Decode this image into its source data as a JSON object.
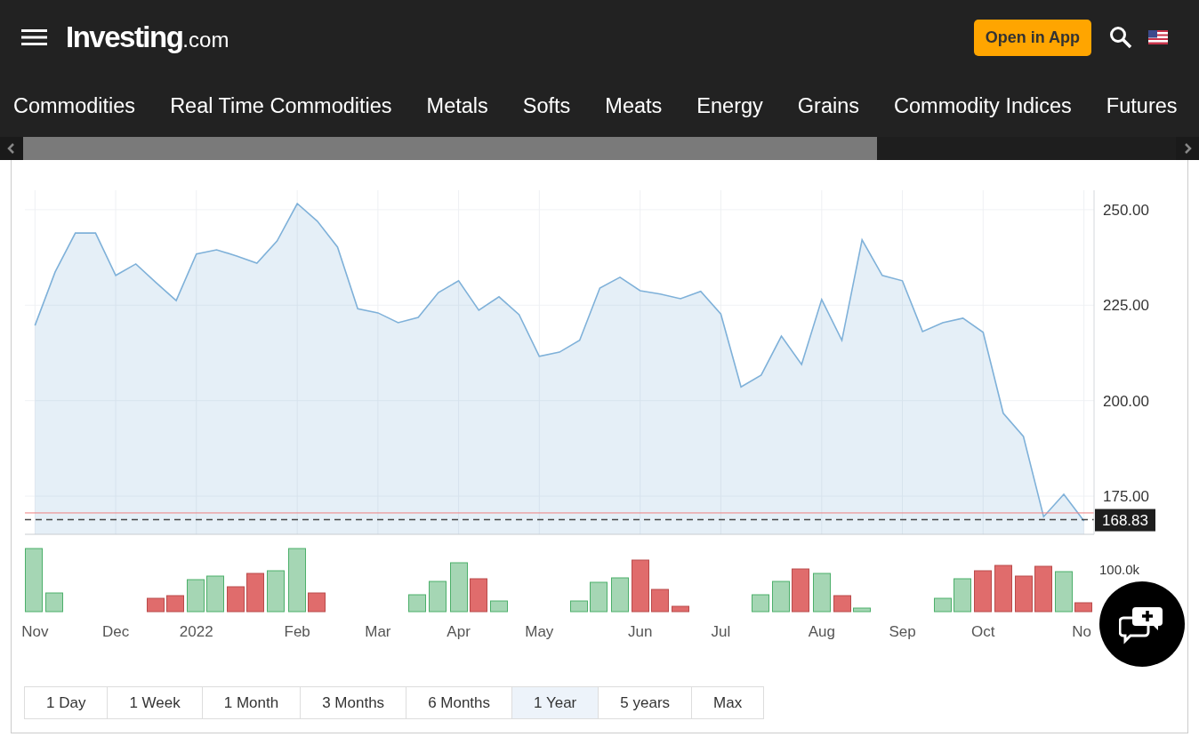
{
  "header": {
    "logo": {
      "name": "Investing",
      "suffix": ".com"
    },
    "open_app_button": "Open in App"
  },
  "nav": {
    "items": [
      "Commodities",
      "Real Time Commodities",
      "Metals",
      "Softs",
      "Meats",
      "Energy",
      "Grains",
      "Commodity Indices",
      "Futures"
    ]
  },
  "chart": {
    "chart_data": {
      "type": "area",
      "grid": true,
      "categories": [
        "Nov",
        null,
        null,
        null,
        "Dec",
        null,
        null,
        null,
        "2022",
        null,
        null,
        null,
        null,
        "Feb",
        null,
        null,
        null,
        "Mar",
        null,
        null,
        null,
        "Apr",
        null,
        null,
        null,
        "May",
        null,
        null,
        null,
        null,
        "Jun",
        null,
        null,
        null,
        "Jul",
        null,
        null,
        null,
        null,
        "Aug",
        null,
        null,
        null,
        "Sep",
        null,
        null,
        null,
        "Oct",
        null,
        null,
        null,
        null,
        "No"
      ],
      "ref_lines": [
        {
          "axis": "y",
          "value": 170.6,
          "color": "#f08080"
        },
        {
          "axis": "y",
          "value": 168.83,
          "color": "#444444",
          "label": "168.83"
        }
      ],
      "series": [
        {
          "color": "#7fb1d9",
          "values": [
            219.7,
            233.7,
            243.9,
            243.9,
            232.8,
            235.8,
            230.9,
            226.2,
            238.4,
            239.5,
            237.9,
            236.0,
            241.8,
            251.6,
            247.0,
            240.2,
            224.1,
            223.0,
            220.4,
            221.8,
            228.3,
            231.4,
            223.7,
            227.2,
            222.5,
            211.6,
            212.7,
            215.8,
            229.5,
            232.3,
            228.8,
            227.9,
            226.7,
            228.6,
            222.7,
            203.6,
            206.7,
            216.9,
            209.5,
            226.5,
            215.8,
            242.1,
            232.8,
            231.4,
            218.1,
            220.4,
            221.6,
            217.9,
            196.7,
            190.6,
            169.6,
            175.5,
            168.5
          ]
        }
      ],
      "ylim": [
        165,
        255.1
      ],
      "yticks": [
        {
          "value": 175,
          "label": "175.00"
        },
        {
          "value": 200,
          "label": "200.00"
        },
        {
          "value": 225,
          "label": "225.00"
        },
        {
          "value": 250,
          "label": "250.00"
        }
      ]
    },
    "volume_tick": "100.0k"
  },
  "ranges": [
    {
      "label": "1 Day",
      "selected": false
    },
    {
      "label": "1 Week",
      "selected": false
    },
    {
      "label": "1 Month",
      "selected": false
    },
    {
      "label": "3 Months",
      "selected": false
    },
    {
      "label": "6 Months",
      "selected": false
    },
    {
      "label": "1 Year",
      "selected": true
    },
    {
      "label": "5 years",
      "selected": false
    },
    {
      "label": "Max",
      "selected": false
    }
  ]
}
